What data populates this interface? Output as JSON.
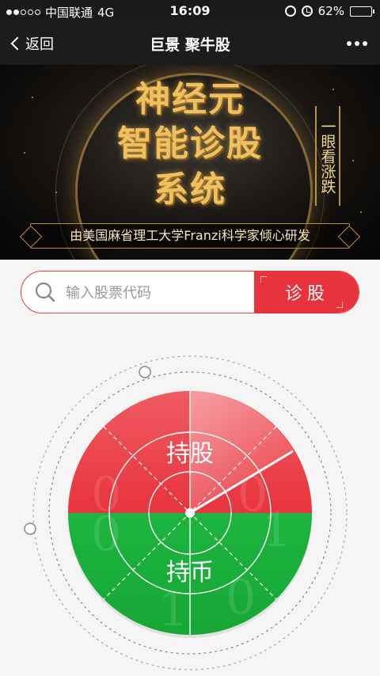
{
  "status_bar": {
    "carrier": "中国联通",
    "network": "4G",
    "time": "16:09",
    "battery": "62%",
    "battery_level": 0.62
  },
  "nav": {
    "back_label": "返回",
    "title": "巨景 聚牛股"
  },
  "banner": {
    "title_lines": [
      "神经元",
      "智能诊股",
      "系统"
    ],
    "side_text": "一眼看涨跌",
    "subtitle": "由美国麻省理工大学Franzi科学家倾心研发"
  },
  "search": {
    "placeholder": "输入股票代码",
    "value": "",
    "button_label": "诊股"
  },
  "dial": {
    "top_label": "持股",
    "bottom_label": "持币",
    "colors": {
      "hold": "#e8333c",
      "cash": "#1db53f"
    }
  }
}
